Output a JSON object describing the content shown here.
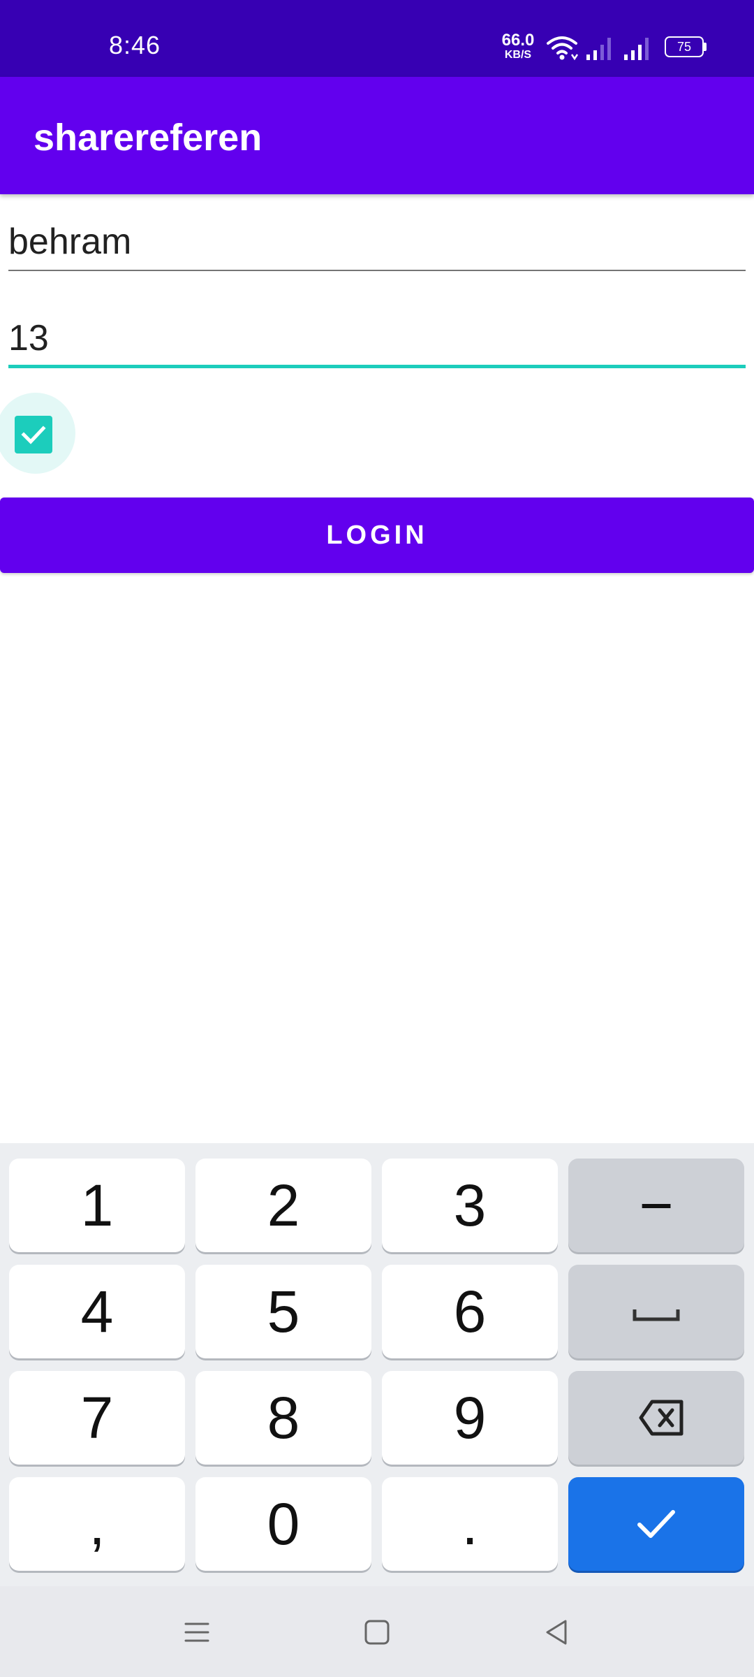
{
  "status_bar": {
    "time": "8:46",
    "net_speed_value": "66.0",
    "net_speed_unit": "KB/S",
    "battery_level": "75",
    "background_color": "#3700b3",
    "icons": [
      "wifi-icon",
      "signal-icon",
      "signal-icon",
      "battery-icon"
    ]
  },
  "app_bar": {
    "title": "sharereferen",
    "color": "#6200ee"
  },
  "form": {
    "name_value": "behram",
    "age_value": "13",
    "age_focused": true,
    "remember_checked": true,
    "accent_color": "#1ccdbc",
    "login_label": "LOGIN"
  },
  "keyboard": {
    "rows": [
      [
        "1",
        "2",
        "3",
        "−"
      ],
      [
        "4",
        "5",
        "6",
        "space"
      ],
      [
        "7",
        "8",
        "9",
        "backspace"
      ],
      [
        ",",
        "0",
        ".",
        "done"
      ]
    ],
    "labels": {
      "k1": "1",
      "k2": "2",
      "k3": "3",
      "minus": "−",
      "k4": "4",
      "k5": "5",
      "k6": "6",
      "k7": "7",
      "k8": "8",
      "k9": "9",
      "comma": ",",
      "k0": "0",
      "period": "."
    },
    "icons": {
      "space": "space-bar-icon",
      "backspace": "backspace-icon",
      "done": "checkmark-icon"
    },
    "done_color": "#1a73e8"
  },
  "nav_bar": {
    "icons": [
      "menu-icon",
      "home-icon",
      "back-icon"
    ]
  }
}
